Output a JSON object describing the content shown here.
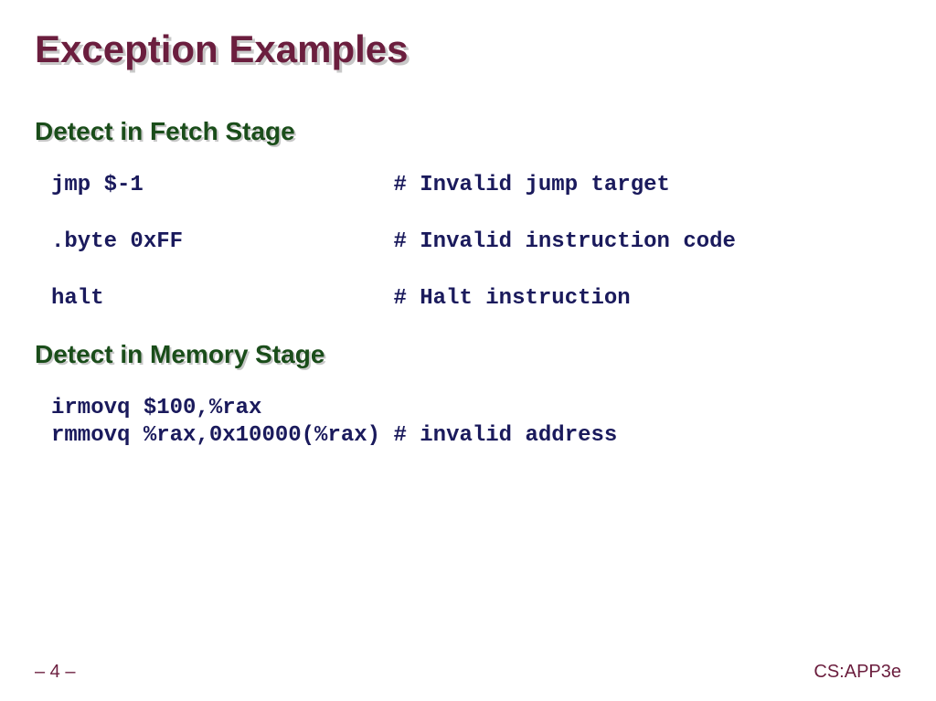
{
  "title": "Exception Examples",
  "sections": {
    "fetch": {
      "header": "Detect in Fetch Stage",
      "lines": {
        "l1": "jmp $-1                   # Invalid jump target",
        "l2": ".byte 0xFF                # Invalid instruction code",
        "l3": "halt                      # Halt instruction"
      }
    },
    "memory": {
      "header": "Detect in Memory Stage",
      "lines": {
        "l1": "irmovq $100,%rax",
        "l2": "rmmovq %rax,0x10000(%rax) # invalid address"
      }
    }
  },
  "footer": {
    "page": "– 4 –",
    "book": "CS:APP3e"
  }
}
